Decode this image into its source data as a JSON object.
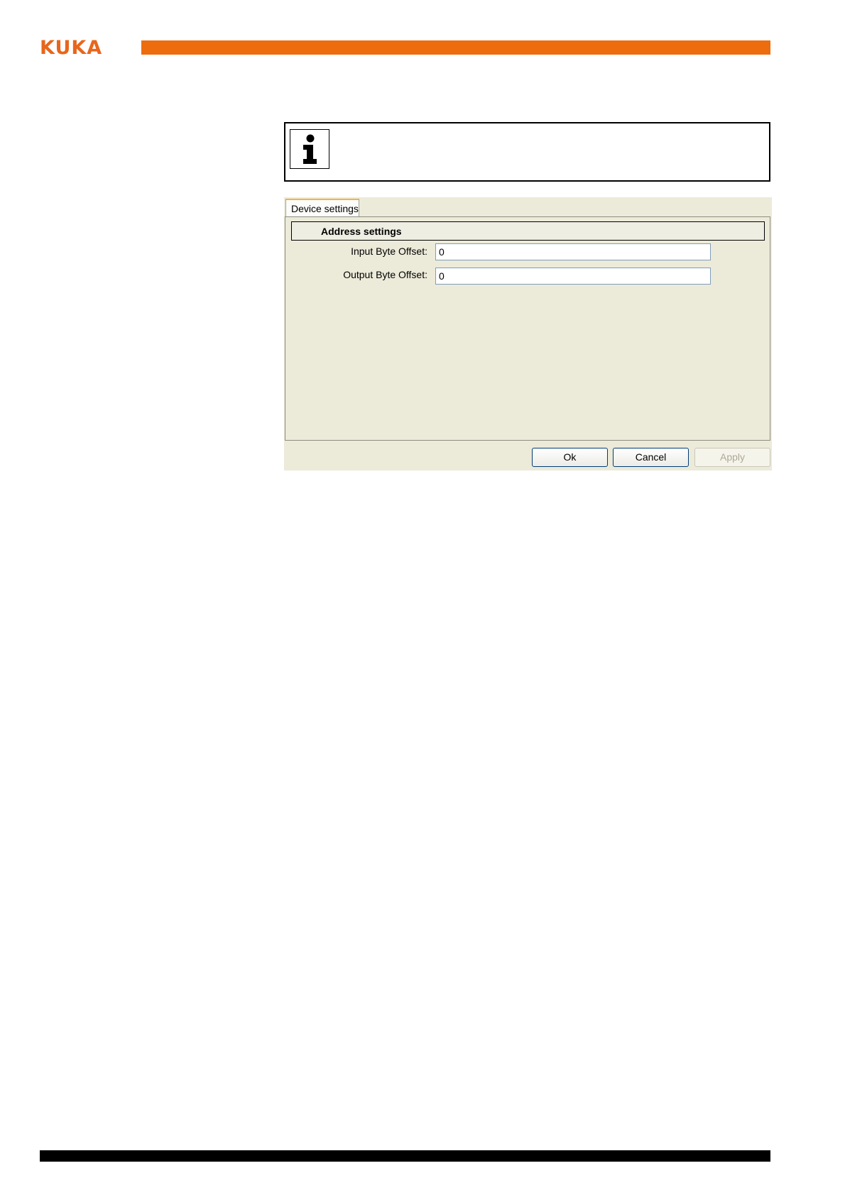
{
  "header": {
    "logo_text": "KUKA",
    "brand_color": "#ec6c0e"
  },
  "info_box": {
    "icon": "info-icon"
  },
  "dialog": {
    "tab_label": "Device settings",
    "section_title": "Address settings",
    "fields": [
      {
        "label": "Input Byte Offset:",
        "value": "0"
      },
      {
        "label": "Output Byte Offset:",
        "value": "0"
      }
    ],
    "buttons": {
      "ok": "Ok",
      "cancel": "Cancel",
      "apply": "Apply"
    }
  }
}
